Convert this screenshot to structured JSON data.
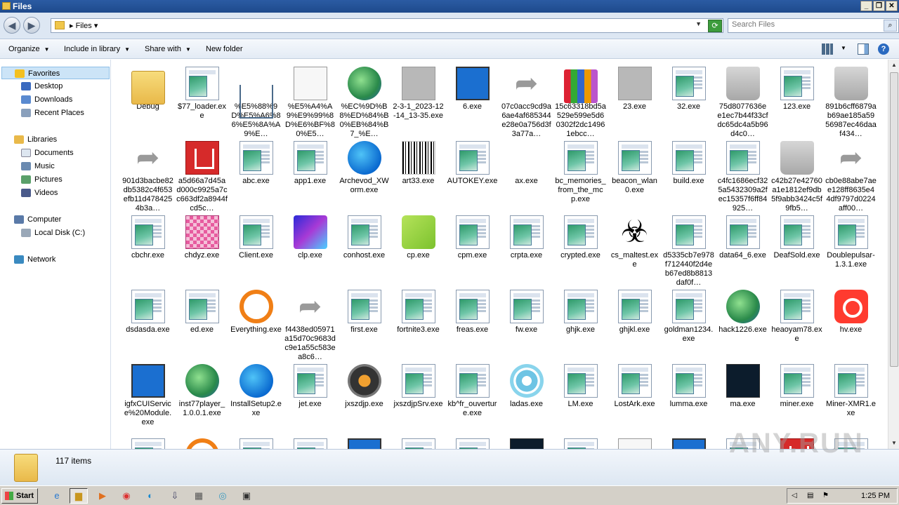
{
  "window": {
    "title": "Files"
  },
  "address": {
    "crumb": "Files",
    "search_placeholder": "Search Files"
  },
  "toolbar": {
    "organize": "Organize",
    "include_in_library": "Include in library",
    "share_with": "Share with",
    "new_folder": "New folder"
  },
  "sidebar": {
    "favorites": "Favorites",
    "desktop": "Desktop",
    "downloads": "Downloads",
    "recent_places": "Recent Places",
    "libraries": "Libraries",
    "documents": "Documents",
    "music": "Music",
    "pictures": "Pictures",
    "videos": "Videos",
    "computer": "Computer",
    "local_disk": "Local Disk (C:)",
    "network": "Network"
  },
  "files": [
    {
      "name": "Debug",
      "icon": "folder"
    },
    {
      "name": "$77_loader.exe",
      "icon": "download-exe"
    },
    {
      "name": "%E5%88%9D%E5%A6%86%E5%8A%A9%E…",
      "icon": "download-tray"
    },
    {
      "name": "%E5%A4%A9%E9%99%8D%E6%BF%80%E5…",
      "icon": "ninja"
    },
    {
      "name": "%EC%9D%B8%ED%84%B0%EB%84%B7_%E…",
      "icon": "globe-server"
    },
    {
      "name": "2-3-1_2023-12-14_13-35.exe",
      "icon": "grey"
    },
    {
      "name": "6.exe",
      "icon": "monitor"
    },
    {
      "name": "07c0acc9cd9a6ae4af685344e28e0a756d3f3a77a…",
      "icon": "arrow"
    },
    {
      "name": "15c63318bd5a529e599e5d60302f2dc14961ebcc…",
      "icon": "books"
    },
    {
      "name": "23.exe",
      "icon": "grey"
    },
    {
      "name": "32.exe",
      "icon": "exe"
    },
    {
      "name": "75d8077636ee1ec7b44f33cfdc65dc4a5b96d4c0…",
      "icon": "trash"
    },
    {
      "name": "123.exe",
      "icon": "exe"
    },
    {
      "name": "891b6cff6879ab69ae185a5956987ec46daaf434…",
      "icon": "trash"
    },
    {
      "name": "901d3bacbe82db5382c4f653efb11d4784254b3a…",
      "icon": "arrow"
    },
    {
      "name": "a5d66a7d45ad000c9925a7cc663df2a8944fcd5c…",
      "icon": "red"
    },
    {
      "name": "abc.exe",
      "icon": "exe"
    },
    {
      "name": "app1.exe",
      "icon": "exe"
    },
    {
      "name": "Archevod_XWorm.exe",
      "icon": "blue"
    },
    {
      "name": "art33.exe",
      "icon": "barcode"
    },
    {
      "name": "AUTOKEY.exe",
      "icon": "exe"
    },
    {
      "name": "ax.exe",
      "icon": "none"
    },
    {
      "name": "bc_memories_from_the_mcp.exe",
      "icon": "exe"
    },
    {
      "name": "beacon_wlan0.exe",
      "icon": "exe"
    },
    {
      "name": "build.exe",
      "icon": "exe"
    },
    {
      "name": "c4fc1686ecf325a5432309a2fec15357f6ff84925…",
      "icon": "exe"
    },
    {
      "name": "c42b27e42760a1e1812ef9db5f9abb3424c5f9fb5…",
      "icon": "trash"
    },
    {
      "name": "cb0e88abe7aee128ff8635e44df9797d0224aff00…",
      "icon": "arrow"
    },
    {
      "name": "cbchr.exe",
      "icon": "exe"
    },
    {
      "name": "chdyz.exe",
      "icon": "pink"
    },
    {
      "name": "Client.exe",
      "icon": "exe"
    },
    {
      "name": "clp.exe",
      "icon": "purple"
    },
    {
      "name": "conhost.exe",
      "icon": "exe"
    },
    {
      "name": "cp.exe",
      "icon": "green-cube"
    },
    {
      "name": "cpm.exe",
      "icon": "exe"
    },
    {
      "name": "crpta.exe",
      "icon": "exe"
    },
    {
      "name": "crypted.exe",
      "icon": "exe"
    },
    {
      "name": "cs_maltest.exe",
      "icon": "biohazard"
    },
    {
      "name": "d5335cb7e978f712440f2d4eb67ed8b8813daf0f…",
      "icon": "exe"
    },
    {
      "name": "data64_6.exe",
      "icon": "exe"
    },
    {
      "name": "DeafSold.exe",
      "icon": "exe"
    },
    {
      "name": "Doublepulsar-1.3.1.exe",
      "icon": "exe"
    },
    {
      "name": "dsdasda.exe",
      "icon": "exe"
    },
    {
      "name": "ed.exe",
      "icon": "exe"
    },
    {
      "name": "Everything.exe",
      "icon": "orange-circle"
    },
    {
      "name": "f4438ed05971a15d70c9683dc9e1a55c583ea8c6…",
      "icon": "arrow"
    },
    {
      "name": "first.exe",
      "icon": "exe"
    },
    {
      "name": "fortnite3.exe",
      "icon": "exe"
    },
    {
      "name": "freas.exe",
      "icon": "exe"
    },
    {
      "name": "fw.exe",
      "icon": "exe"
    },
    {
      "name": "ghjk.exe",
      "icon": "exe"
    },
    {
      "name": "ghjkl.exe",
      "icon": "exe"
    },
    {
      "name": "goldman1234.exe",
      "icon": "exe"
    },
    {
      "name": "hack1226.exe",
      "icon": "globe-server"
    },
    {
      "name": "heaoyam78.exe",
      "icon": "exe"
    },
    {
      "name": "hv.exe",
      "icon": "orange-app"
    },
    {
      "name": "igfxCUIService%20Module.exe",
      "icon": "monitor"
    },
    {
      "name": "inst77player_1.0.0.1.exe",
      "icon": "globe"
    },
    {
      "name": "InstallSetup2.exe",
      "icon": "blue"
    },
    {
      "name": "jet.exe",
      "icon": "exe"
    },
    {
      "name": "jxszdjp.exe",
      "icon": "jxs"
    },
    {
      "name": "jxszdjpSrv.exe",
      "icon": "exe"
    },
    {
      "name": "kb^fr_ouverture.exe",
      "icon": "exe"
    },
    {
      "name": "ladas.exe",
      "icon": "cyan"
    },
    {
      "name": "LM.exe",
      "icon": "exe"
    },
    {
      "name": "LostArk.exe",
      "icon": "exe"
    },
    {
      "name": "lumma.exe",
      "icon": "exe"
    },
    {
      "name": "ma.exe",
      "icon": "dark"
    },
    {
      "name": "miner.exe",
      "icon": "exe"
    },
    {
      "name": "Miner-XMR1.exe",
      "icon": "exe"
    },
    {
      "name": "",
      "icon": "exe"
    },
    {
      "name": "",
      "icon": "user"
    },
    {
      "name": "",
      "icon": "exe"
    },
    {
      "name": "",
      "icon": "exe"
    },
    {
      "name": "",
      "icon": "blue-settings"
    },
    {
      "name": "",
      "icon": "exe"
    },
    {
      "name": "",
      "icon": "exe"
    },
    {
      "name": "",
      "icon": "dark"
    },
    {
      "name": "",
      "icon": "exe"
    },
    {
      "name": "",
      "icon": "network"
    },
    {
      "name": "",
      "icon": "monitor"
    },
    {
      "name": "",
      "icon": "exe"
    },
    {
      "name": "",
      "icon": "red"
    },
    {
      "name": "",
      "icon": "exe"
    }
  ],
  "status": {
    "count": "117 items"
  },
  "watermark": "ANY.RUN",
  "taskbar": {
    "start": "Start",
    "clock": "1:25 PM"
  }
}
